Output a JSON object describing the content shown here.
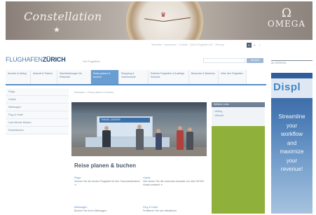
{
  "banner": {
    "script_text": "Constellation",
    "star_glyph": "★",
    "crown_glyph": "♛",
    "brand_symbol": "Ω",
    "brand_word": "OMEGA"
  },
  "utility": {
    "links": "Startseite · Impressum · Kontakt · Zürich-Flughafen AG · Sitemap",
    "lang_de": "D",
    "lang_en": "E",
    "lang_it": "I"
  },
  "header": {
    "logo_part1": "FLUGHAFEN",
    "logo_part2": "ZÜRICH",
    "site_label": "Die Flughäfen",
    "search_placeholder": "",
    "search_button": "Suchen"
  },
  "nav": {
    "items": [
      {
        "label": "Anreise & Abflug"
      },
      {
        "label": "Ankunft & Parken"
      },
      {
        "label": "Dienstleistungen für Reisende"
      },
      {
        "label": "Reise planen & buchen"
      },
      {
        "label": "Shopping & Gastronomie"
      },
      {
        "label": "Erlebnis Flughafen & Ausflüge Schweiz"
      },
      {
        "label": "Besucher & Besteres"
      },
      {
        "label": "Über den Flughafen"
      }
    ]
  },
  "sidebar": {
    "items": [
      {
        "label": "Flüge"
      },
      {
        "label": "Hotels"
      },
      {
        "label": "Mietwagen"
      },
      {
        "label": "Flug & Hotel"
      },
      {
        "label": "Last Minute Reisen"
      },
      {
        "label": "Reisethemen"
      }
    ]
  },
  "main": {
    "breadcrumb": "Startseite > Reise planen & buchen",
    "hero_sign": "TRAVEL CENTER",
    "section_title": "Reise planen & buchen",
    "teasers": [
      {
        "title": "Flüge",
        "text": "Suchen Sie die besten Flugtarife für Ihre Traumdestination! ➔"
      },
      {
        "title": "Hotels",
        "text": "Hier finden Sie die maximale Auswahl von über 50'000 Hotels weltweit ➔"
      },
      {
        "title": "Mietwagen",
        "text": "Buchen Sie Ihren Mietwagen"
      },
      {
        "title": "Flug & Hotel",
        "text": "Profitieren Sie vom attraktiven"
      }
    ]
  },
  "widget": {
    "head": "Weitere Links",
    "links": [
      "› Anflug",
      "› Ankunft"
    ]
  },
  "ad": {
    "tag": "AD SERVING",
    "brand": "Displ",
    "copy_lines": [
      "Streamline",
      "your",
      "workflow",
      "and",
      "maximize",
      "your",
      "revenue!"
    ]
  },
  "colors": {
    "nav_active": "#6a9ed3",
    "logo_dark": "#1e4677",
    "widget_green": "#8fb03a",
    "ad_blue": "#2f5b9a"
  }
}
